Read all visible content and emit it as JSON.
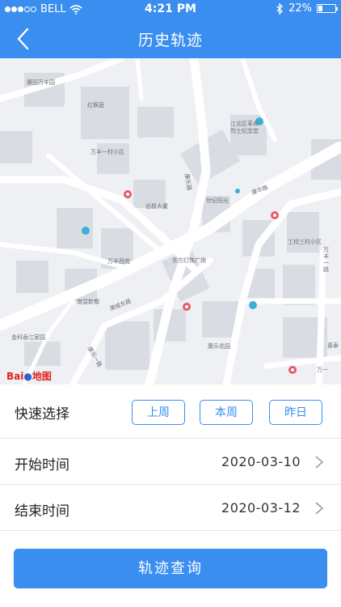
{
  "status_bar": {
    "carrier": "BELL",
    "time": "4:21 PM",
    "battery": "22%",
    "battery_level": 0.22
  },
  "nav": {
    "title": "历史轨迹",
    "back_icon": "chevron-left-icon"
  },
  "map": {
    "logo_text_a": "Bai",
    "logo_text_b": "地图",
    "labels": [
      "康田万丰园",
      "红枫庭",
      "万丰一村小区",
      "远极大厦",
      "万丰西苑",
      "东方灯饰广场",
      "南益新都",
      "金科香江家园",
      "康乐花园",
      "江北区革命烈士纪念堂",
      "世纪阳光",
      "工校三村小区",
      "万丰一路",
      "康乐路",
      "港城东路",
      "康乐一路",
      "嘉泰",
      "万一",
      "康华路"
    ]
  },
  "quick_select": {
    "label": "快速选择",
    "options": [
      "上周",
      "本周",
      "昨日"
    ]
  },
  "start": {
    "label": "开始时间",
    "value": "2020-03-10"
  },
  "end": {
    "label": "结束时间",
    "value": "2020-03-12"
  },
  "query_button": "轨迹查询",
  "colors": {
    "accent": "#3a8ef0",
    "map_bg": "#eef0f3",
    "road": "#ffffff",
    "building": "#d9dde3",
    "poi_red": "#e75a6a",
    "poi_blue": "#3ab0d8"
  }
}
